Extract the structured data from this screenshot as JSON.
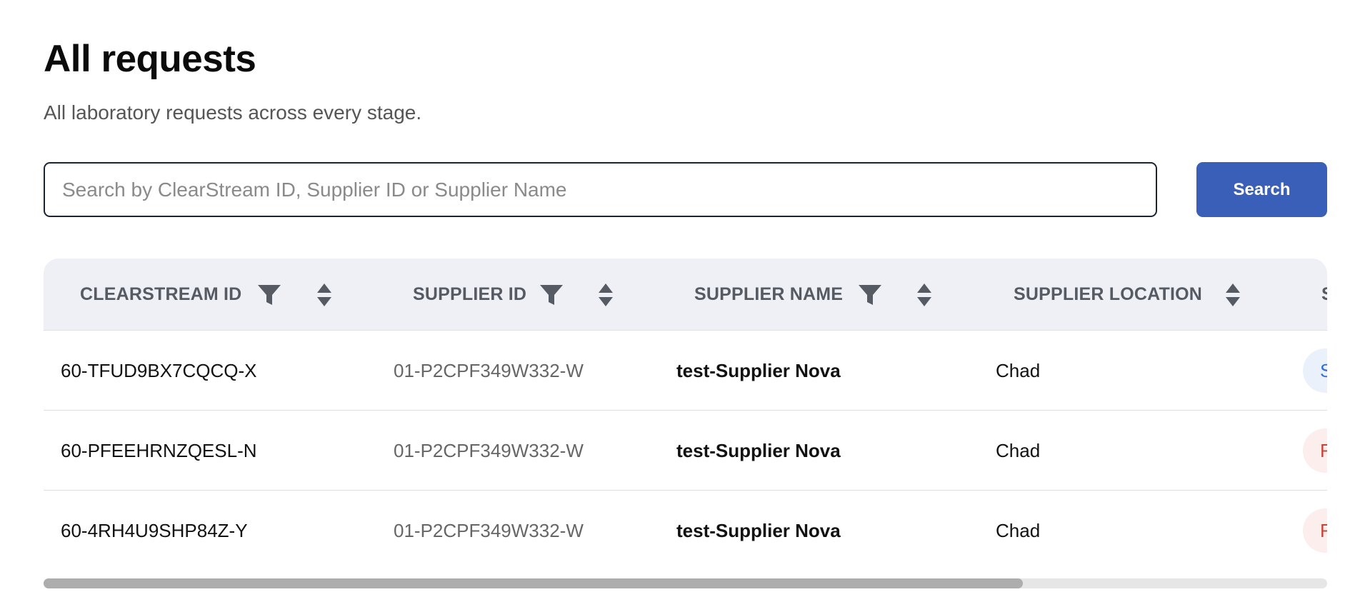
{
  "page": {
    "title": "All requests",
    "subtitle": "All laboratory requests across every stage."
  },
  "search": {
    "placeholder": "Search by ClearStream ID, Supplier ID or Supplier Name",
    "value": "",
    "button_label": "Search"
  },
  "table": {
    "columns": [
      {
        "key": "clearstream_id",
        "label": "CLEARSTREAM ID",
        "filterable": true,
        "sortable": true
      },
      {
        "key": "supplier_id",
        "label": "SUPPLIER ID",
        "filterable": true,
        "sortable": true
      },
      {
        "key": "supplier_name",
        "label": "SUPPLIER NAME",
        "filterable": true,
        "sortable": true
      },
      {
        "key": "supplier_location",
        "label": "SUPPLIER LOCATION",
        "filterable": false,
        "sortable": true
      },
      {
        "key": "status",
        "label": "S",
        "filterable": false,
        "sortable": false
      }
    ],
    "rows": [
      {
        "clearstream_id": "60-TFUD9BX7CQCQ-X",
        "supplier_id": "01-P2CPF349W332-W",
        "supplier_name": "test-Supplier Nova",
        "supplier_location": "Chad",
        "status": "S",
        "status_color": "#2f6fd6",
        "status_bg": "#eaf1fb"
      },
      {
        "clearstream_id": "60-PFEEHRNZQESL-N",
        "supplier_id": "01-P2CPF349W332-W",
        "supplier_name": "test-Supplier Nova",
        "supplier_location": "Chad",
        "status": "F",
        "status_color": "#c8453a",
        "status_bg": "#fbeeed"
      },
      {
        "clearstream_id": "60-4RH4U9SHP84Z-Y",
        "supplier_id": "01-P2CPF349W332-W",
        "supplier_name": "test-Supplier Nova",
        "supplier_location": "Chad",
        "status": "F",
        "status_color": "#c8453a",
        "status_bg": "#fbeeed"
      }
    ]
  },
  "scrollbar": {
    "horizontal_position_fraction": 0.0,
    "visible_fraction": 0.763
  },
  "colors": {
    "accent": "#3a5fb8",
    "header_bg": "#eef0f5",
    "header_text": "#555a63"
  },
  "icons": {
    "filter": "filter-icon",
    "sort": "sort-icon"
  }
}
